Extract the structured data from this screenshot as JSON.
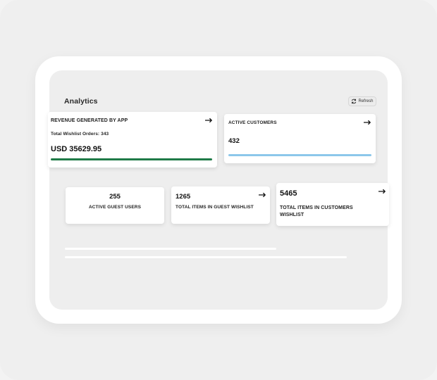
{
  "header": {
    "title": "Analytics",
    "refresh_label": "Refresh"
  },
  "cards": {
    "revenue": {
      "title": "REVENUE GENERATED BY APP",
      "subtitle": "Total Wishlist Orders: 343",
      "value": "USD 35629.95",
      "bar_color": "#1f7a47"
    },
    "active_customers": {
      "title": "ACTIVE CUSTOMERS",
      "value": "432",
      "bar_color": "#8cc7ea"
    },
    "guest_users": {
      "value": "255",
      "title": "ACTIVE GUEST USERS"
    },
    "guest_wishlist": {
      "value": "1265",
      "title": "TOTAL ITEMS IN GUEST WISHLIST"
    },
    "customers_wishlist": {
      "value": "5465",
      "title": "TOTAL ITEMS IN CUSTOMERS WISHLIST"
    }
  },
  "icons": {
    "refresh": "refresh-icon",
    "arrow": "arrow-right-icon"
  }
}
